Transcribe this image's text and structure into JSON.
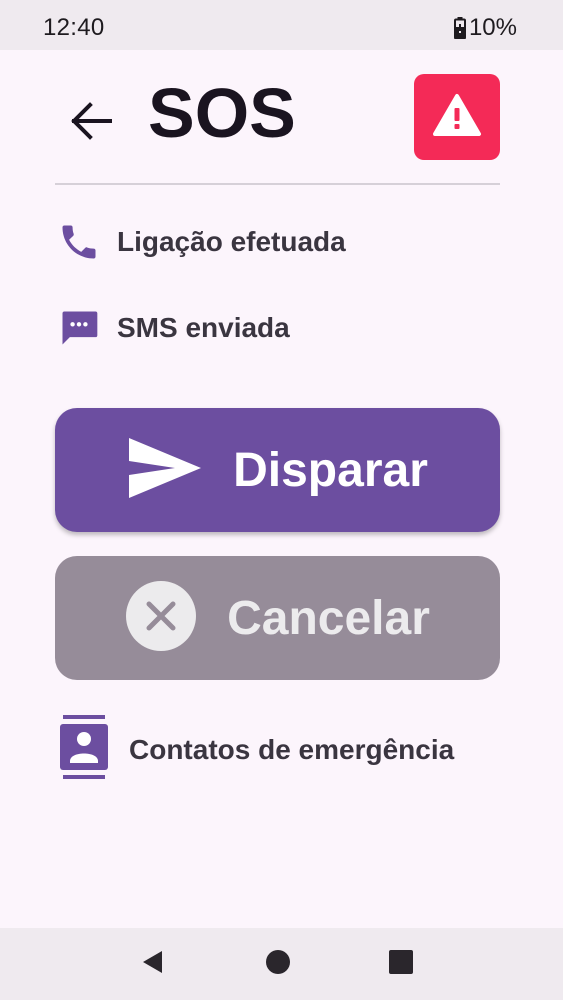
{
  "status_bar": {
    "time": "12:40",
    "battery": "10%"
  },
  "header": {
    "title": "SOS",
    "back_icon": "arrow-left-icon",
    "alert_icon": "warning-triangle-icon",
    "alert_color": "#f42a57"
  },
  "status_items": [
    {
      "icon": "phone-icon",
      "label": "Ligação efetuada"
    },
    {
      "icon": "sms-icon",
      "label": "SMS enviada"
    }
  ],
  "actions": {
    "fire": {
      "label": "Disparar",
      "icon": "send-icon",
      "color": "#6c4ea0"
    },
    "cancel": {
      "label": "Cancelar",
      "icon": "cancel-circle-icon",
      "color": "#968c99"
    }
  },
  "contacts": {
    "label": "Contatos de emergência",
    "icon": "contacts-icon"
  },
  "colors": {
    "accent": "#6c4ea0",
    "background": "#fcf5fc"
  }
}
